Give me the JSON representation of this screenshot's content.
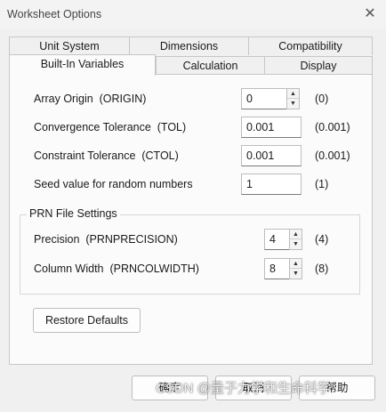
{
  "window": {
    "title": "Worksheet Options",
    "close_icon": "close-icon"
  },
  "tabs": {
    "back_row": [
      "Unit System",
      "Dimensions",
      "Compatibility"
    ],
    "front_row": [
      "Built-In Variables",
      "Calculation",
      "Display"
    ],
    "active": "Built-In Variables"
  },
  "variables": [
    {
      "label": "Array Origin  (ORIGIN)",
      "value": "0",
      "default": "(0)",
      "control": "spinner"
    },
    {
      "label": "Convergence Tolerance  (TOL)",
      "value": "0.001",
      "default": "(0.001)",
      "control": "text"
    },
    {
      "label": "Constraint Tolerance  (CTOL)",
      "value": "0.001",
      "default": "(0.001)",
      "control": "text"
    },
    {
      "label": "Seed value for random numbers",
      "value": "1",
      "default": "(1)",
      "control": "text"
    }
  ],
  "prn": {
    "title": "PRN File Settings",
    "items": [
      {
        "label": "Precision  (PRNPRECISION)",
        "value": "4",
        "default": "(4)"
      },
      {
        "label": "Column Width  (PRNCOLWIDTH)",
        "value": "8",
        "default": "(8)"
      }
    ]
  },
  "buttons": {
    "restore": "Restore Defaults",
    "ok": "确定",
    "cancel": "取消",
    "help": "帮助"
  },
  "watermark": "CSDN @量子力学和生命科学"
}
